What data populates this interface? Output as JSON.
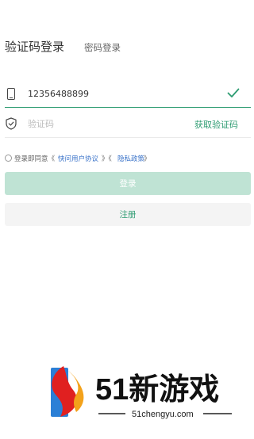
{
  "tabs": {
    "active": "验证码登录",
    "inactive": "密码登录"
  },
  "phone": {
    "value": "12356488899",
    "placeholder": ""
  },
  "code": {
    "placeholder": "验证码",
    "get_code_label": "获取验证码"
  },
  "agreement": {
    "prefix": "登录即同意《",
    "user_agreement": "快问用户协议",
    "separator": "》《",
    "privacy_policy": "隐私政策",
    "suffix": "》"
  },
  "buttons": {
    "login": "登录",
    "register": "注册"
  },
  "watermark": {
    "brand": "51新游戏",
    "url": "51chengyu.com"
  },
  "colors": {
    "accent": "#2e9c72",
    "login_disabled": "#bfe3d4",
    "link": "#3a73c9"
  },
  "icons": {
    "phone": "phone-icon",
    "shield": "shield-check-icon",
    "check": "check-icon"
  }
}
